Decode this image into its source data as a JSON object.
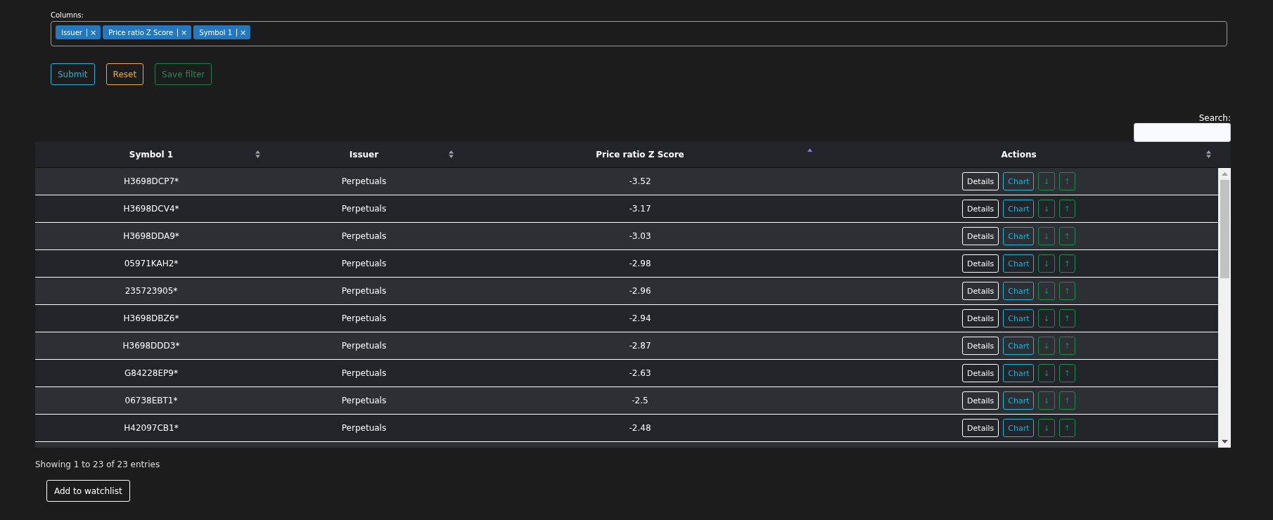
{
  "columns_filter": {
    "label": "Columns:",
    "tags": [
      {
        "label": "Issuer",
        "remove": "×"
      },
      {
        "label": "Price ratio Z Score",
        "remove": "×"
      },
      {
        "label": "Symbol 1",
        "remove": "×"
      }
    ]
  },
  "buttons": [
    {
      "label": "Submit",
      "kind": "info"
    },
    {
      "label": "Reset",
      "kind": "warning"
    },
    {
      "label": "Save filter",
      "kind": "success"
    }
  ],
  "search": {
    "label": "Search:"
  },
  "table": {
    "columns": [
      {
        "label": "Symbol 1",
        "sorted_ascending": false
      },
      {
        "label": "Issuer",
        "sorted_ascending": false
      },
      {
        "label": "Price ratio Z Score",
        "sorted_ascending": true
      },
      {
        "label": "Actions",
        "sorted_ascending": false
      }
    ],
    "rows": [
      {
        "cells": [
          "H3698DCP7*",
          "Perpetuals",
          "-3.52"
        ],
        "actions": [
          {
            "label": "Details",
            "kind": "light"
          },
          {
            "label": "Chart",
            "kind": "info"
          },
          {
            "label": "↓",
            "kind": "success"
          },
          {
            "label": "↑",
            "kind": "success"
          }
        ]
      },
      {
        "cells": [
          "H3698DCV4*",
          "Perpetuals",
          "-3.17"
        ],
        "actions": [
          {
            "label": "Details",
            "kind": "light"
          },
          {
            "label": "Chart",
            "kind": "info"
          },
          {
            "label": "↓",
            "kind": "success"
          },
          {
            "label": "↑",
            "kind": "success"
          }
        ]
      },
      {
        "cells": [
          "H3698DDA9*",
          "Perpetuals",
          "-3.03"
        ],
        "actions": [
          {
            "label": "Details",
            "kind": "light"
          },
          {
            "label": "Chart",
            "kind": "info"
          },
          {
            "label": "↓",
            "kind": "success"
          },
          {
            "label": "↑",
            "kind": "success"
          }
        ]
      },
      {
        "cells": [
          "05971KAH2*",
          "Perpetuals",
          "-2.98"
        ],
        "actions": [
          {
            "label": "Details",
            "kind": "light"
          },
          {
            "label": "Chart",
            "kind": "info"
          },
          {
            "label": "↓",
            "kind": "success"
          },
          {
            "label": "↑",
            "kind": "success"
          }
        ]
      },
      {
        "cells": [
          "235723905*",
          "Perpetuals",
          "-2.96"
        ],
        "actions": [
          {
            "label": "Details",
            "kind": "light"
          },
          {
            "label": "Chart",
            "kind": "info"
          },
          {
            "label": "↓",
            "kind": "success"
          },
          {
            "label": "↑",
            "kind": "success"
          }
        ]
      },
      {
        "cells": [
          "H3698DBZ6*",
          "Perpetuals",
          "-2.94"
        ],
        "actions": [
          {
            "label": "Details",
            "kind": "light"
          },
          {
            "label": "Chart",
            "kind": "info"
          },
          {
            "label": "↓",
            "kind": "success"
          },
          {
            "label": "↑",
            "kind": "success"
          }
        ]
      },
      {
        "cells": [
          "H3698DDD3*",
          "Perpetuals",
          "-2.87"
        ],
        "actions": [
          {
            "label": "Details",
            "kind": "light"
          },
          {
            "label": "Chart",
            "kind": "info"
          },
          {
            "label": "↓",
            "kind": "success"
          },
          {
            "label": "↑",
            "kind": "success"
          }
        ]
      },
      {
        "cells": [
          "G84228EP9*",
          "Perpetuals",
          "-2.63"
        ],
        "actions": [
          {
            "label": "Details",
            "kind": "light"
          },
          {
            "label": "Chart",
            "kind": "info"
          },
          {
            "label": "↓",
            "kind": "success"
          },
          {
            "label": "↑",
            "kind": "success"
          }
        ]
      },
      {
        "cells": [
          "06738EBT1*",
          "Perpetuals",
          "-2.5"
        ],
        "actions": [
          {
            "label": "Details",
            "kind": "light"
          },
          {
            "label": "Chart",
            "kind": "info"
          },
          {
            "label": "↓",
            "kind": "success"
          },
          {
            "label": "↑",
            "kind": "success"
          }
        ]
      },
      {
        "cells": [
          "H42097CB1*",
          "Perpetuals",
          "-2.48"
        ],
        "actions": [
          {
            "label": "Details",
            "kind": "light"
          },
          {
            "label": "Chart",
            "kind": "info"
          },
          {
            "label": "↓",
            "kind": "success"
          },
          {
            "label": "↑",
            "kind": "success"
          }
        ]
      }
    ]
  },
  "info": "Showing 1 to 23 of 23 entries",
  "watchlist_button": "Add to watchlist"
}
